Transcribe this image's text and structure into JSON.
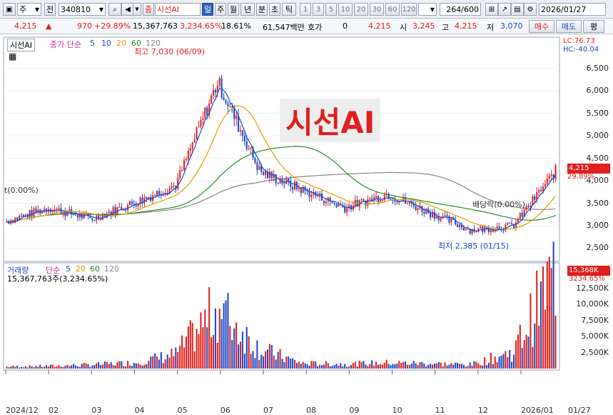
{
  "toolbar": {
    "period_label": "주",
    "prev_label": "전",
    "code": "340810",
    "type_tag": "종",
    "stock_name": "시선AI",
    "periods": [
      "일",
      "주",
      "월",
      "년",
      "분",
      "초",
      "틱"
    ],
    "selected_period": "일",
    "intervals": [
      "1",
      "3",
      "5",
      "10",
      "20",
      "30",
      "60",
      "120"
    ],
    "count_current": "264",
    "count_total": "/600",
    "date": "2026/01/27"
  },
  "quote": {
    "price": "4,215",
    "change": "970",
    "change_pct": "+29.89%",
    "volume": "15,367,763",
    "volume_pct": "3,234.65%",
    "turnover": "18.61%",
    "amount": "61,547백만",
    "hoga_label": "호가",
    "hoga_value": "0",
    "hoga_price": "4,215",
    "open_label": "시",
    "open": "3,245",
    "high_label": "고",
    "high": "4,215",
    "low_label": "저",
    "low": "3,070",
    "buy_label": "매수",
    "sell_label": "매도",
    "eval_label": "평"
  },
  "chart": {
    "watermark": "시선AI",
    "price_legend": {
      "name": "시선AI",
      "ma_label": "종가 단순",
      "periods": [
        "5",
        "10",
        "20",
        "60",
        "120"
      ],
      "colors": [
        "#1c48c8",
        "#1c48c8",
        "#e0a000",
        "#2a8a2a",
        "#888888"
      ]
    },
    "lc": "LC:76.73",
    "hc": "HC:-40.04",
    "current_price_tag": "4,215",
    "current_pct_tag": "29.89%",
    "high_annotation": "최고 7,030 (06/09)",
    "low_annotation": "최저 2,385 (01/15)",
    "dividend_annotation": "배당락(0.00%)",
    "left_annotation": "t(0.00%)",
    "price_axis": [
      "6,500",
      "6,000",
      "5,500",
      "5,000",
      "4,500",
      "4,000",
      "3,500",
      "3,000",
      "2,500"
    ],
    "volume_legend": {
      "name": "거래량",
      "ma_label": "단순",
      "periods": [
        "5",
        "20",
        "60",
        "120"
      ],
      "value": "15,367,763주(3,234.65%)"
    },
    "volume_tag": "15,368K",
    "volume_pct_tag": "3234.65%",
    "volume_axis": [
      "12,500K",
      "10,000K",
      "7,500K",
      "5,000K",
      "2,500K"
    ],
    "x_axis": [
      "2024/12",
      "02",
      "03",
      "04",
      "05",
      "06",
      "07",
      "08",
      "09",
      "10",
      "11",
      "12",
      "2026/01",
      "01/27"
    ]
  },
  "chart_data": {
    "type": "candlestick",
    "x": [
      "2024/12",
      "2025/02",
      "2025/03",
      "2025/04",
      "2025/05",
      "2025/06",
      "2025/07",
      "2025/08",
      "2025/09",
      "2025/10",
      "2025/11",
      "2025/12",
      "2026/01",
      "2026/01/27"
    ],
    "close": [
      3100,
      3400,
      3150,
      3500,
      3900,
      6200,
      4200,
      3800,
      3400,
      3700,
      3300,
      2900,
      3000,
      4215
    ],
    "volume_k": [
      300,
      400,
      600,
      900,
      2200,
      9500,
      3000,
      800,
      700,
      900,
      800,
      600,
      2600,
      15368
    ],
    "ylim": [
      2300,
      7100
    ],
    "volume_ylim": [
      0,
      15400
    ]
  }
}
